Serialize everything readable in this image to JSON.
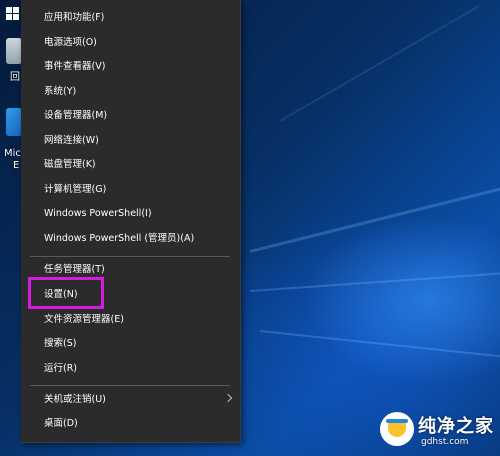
{
  "menu": {
    "groups": [
      {
        "items": [
          {
            "label": "应用和功能(F)",
            "has_submenu": false
          },
          {
            "label": "电源选项(O)",
            "has_submenu": false
          },
          {
            "label": "事件查看器(V)",
            "has_submenu": false
          },
          {
            "label": "系统(Y)",
            "has_submenu": false
          },
          {
            "label": "设备管理器(M)",
            "has_submenu": false
          },
          {
            "label": "网络连接(W)",
            "has_submenu": false
          },
          {
            "label": "磁盘管理(K)",
            "has_submenu": false
          },
          {
            "label": "计算机管理(G)",
            "has_submenu": false
          },
          {
            "label": "Windows PowerShell(I)",
            "has_submenu": false
          },
          {
            "label": "Windows PowerShell (管理员)(A)",
            "has_submenu": false
          }
        ]
      },
      {
        "items": [
          {
            "label": "任务管理器(T)",
            "has_submenu": false
          },
          {
            "label": "设置(N)",
            "has_submenu": false,
            "highlighted": true
          },
          {
            "label": "文件资源管理器(E)",
            "has_submenu": false
          },
          {
            "label": "搜索(S)",
            "has_submenu": false
          },
          {
            "label": "运行(R)",
            "has_submenu": false
          }
        ]
      },
      {
        "items": [
          {
            "label": "关机或注销(U)",
            "has_submenu": true
          },
          {
            "label": "桌面(D)",
            "has_submenu": false
          }
        ]
      }
    ]
  },
  "desktop_icons": [
    {
      "label": "回",
      "icon": "recycle-bin-icon"
    },
    {
      "label": "Mic",
      "icon": "edge-icon"
    },
    {
      "label": "E",
      "icon": "edge-icon"
    }
  ],
  "watermark": {
    "title": "纯净之家",
    "url": "gdhst.com"
  },
  "colors": {
    "menu_bg": "#2b2b2b",
    "menu_text": "#ffffff",
    "separator": "#5a5a5a",
    "highlight": "#d51be0"
  }
}
